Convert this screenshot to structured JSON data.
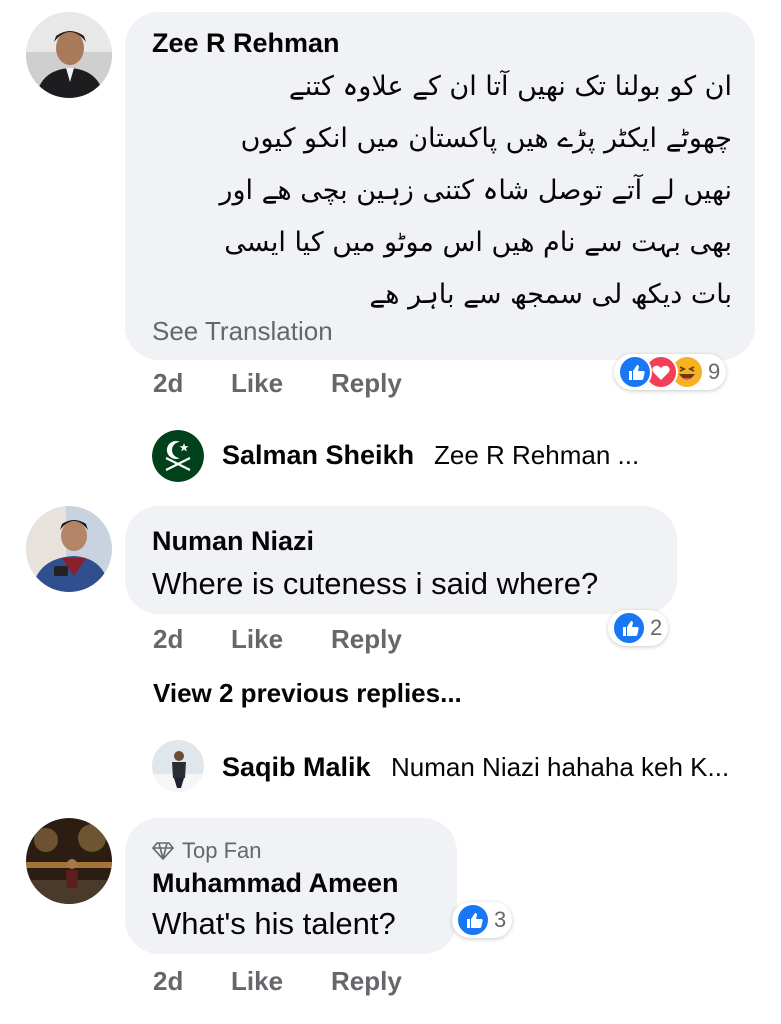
{
  "comments": [
    {
      "author": "Zee R Rehman",
      "urdu_lines": [
        "ان کو بولنا  تک نهیں آتا ان کے علاوہ کتنے",
        "چھوٹے ایکٹر پڑے  هیں پاکستان میں انکو کیوں",
        "نهیں لے آتے توصل شاہ کتنی زہین بچی هے اور",
        "بھی بہت سے نام هیں اس موٹو میں کیا ایسی",
        "بات دیکھ لی سمجھ سے باہر هے"
      ],
      "see_translation": "See Translation",
      "time": "2d",
      "like": "Like",
      "reply": "Reply",
      "reaction_count": "9",
      "reactions": [
        "like-icon",
        "love-icon",
        "haha-icon"
      ]
    },
    {
      "author": "Numan Niazi",
      "text": "Where is cuteness i said where?",
      "time": "2d",
      "like": "Like",
      "reply": "Reply",
      "reaction_count": "2",
      "view_previous": "View 2 previous replies..."
    },
    {
      "badge": "Top Fan",
      "badge_icon": "diamond-icon",
      "author": "Muhammad Ameen",
      "text": "What's his talent?",
      "time": "2d",
      "like": "Like",
      "reply": "Reply",
      "reaction_count": "3"
    }
  ],
  "replies": [
    {
      "author": "Salman Sheikh",
      "preview": "Zee R Rehman ..."
    },
    {
      "author": "Saqib Malik",
      "preview": "Numan Niazi hahaha keh K..."
    }
  ],
  "colors": {
    "bubble": "#f0f2f5",
    "secondary_text": "#65676b",
    "like_blue": "#1877f2",
    "love_red": "#f33e58",
    "haha_yellow": "#f7b125"
  }
}
